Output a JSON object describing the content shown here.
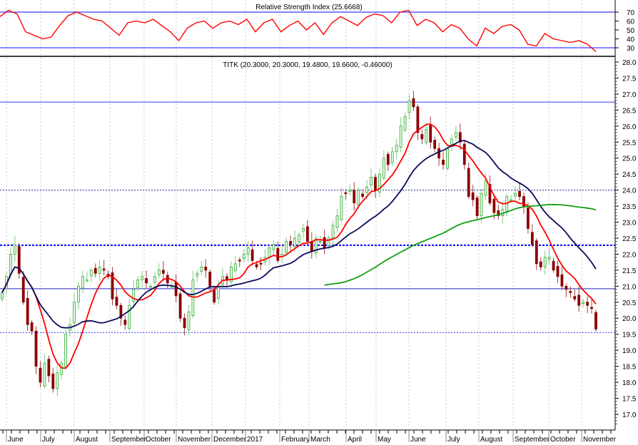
{
  "chart_data": {
    "type": "candlestick",
    "symbol": "TITK",
    "title": "TITK (20.3000, 20.3000, 19.4800, 19.6600, -0.46000)",
    "ylim": [
      16.5,
      28.2
    ],
    "y_ticks": [
      "28.0",
      "27.5",
      "27.0",
      "26.5",
      "26.0",
      "25.5",
      "25.0",
      "24.5",
      "24.0",
      "23.5",
      "23.0",
      "22.5",
      "22.0",
      "21.5",
      "21.0",
      "20.5",
      "20.0",
      "19.5",
      "19.0",
      "18.5",
      "18.0",
      "17.5",
      "17.0"
    ],
    "x_labels": [
      "June",
      "July",
      "August",
      "September",
      "October",
      "November",
      "December",
      "2017",
      "February",
      "March",
      "April",
      "May",
      "June",
      "July",
      "August",
      "September",
      "October",
      "November"
    ],
    "closes": [
      20.8,
      21.3,
      22.0,
      22.3,
      21.4,
      20.5,
      19.8,
      19.6,
      18.5,
      18.0,
      18.6,
      18.2,
      17.8,
      18.3,
      18.6,
      19.5,
      19.8,
      20.5,
      21.0,
      21.3,
      21.2,
      21.5,
      21.4,
      21.6,
      21.5,
      21.3,
      20.6,
      20.4,
      20.0,
      19.8,
      20.4,
      20.9,
      21.2,
      21.3,
      21.1,
      21.0,
      21.3,
      21.5,
      21.4,
      21.1,
      21.0,
      20.7,
      20.0,
      19.7,
      20.2,
      21.2,
      21.4,
      21.6,
      21.5,
      21.0,
      20.5,
      21.0,
      21.3,
      21.2,
      21.6,
      21.7,
      21.8,
      22.0,
      22.2,
      21.8,
      21.6,
      21.7,
      21.9,
      22.2,
      22.3,
      21.8,
      22.0,
      22.4,
      22.3,
      22.5,
      22.6,
      22.8,
      22.4,
      22.1,
      22.5,
      22.4,
      22.2,
      22.5,
      22.9,
      23.2,
      23.8,
      23.9,
      24.0,
      23.6,
      24.0,
      23.8,
      24.1,
      24.4,
      24.0,
      24.5,
      25.0,
      24.8,
      25.2,
      25.4,
      26.0,
      26.3,
      26.8,
      26.6,
      25.8,
      25.6,
      25.9,
      25.5,
      25.3,
      25.0,
      24.8,
      25.3,
      25.6,
      25.8,
      25.5,
      24.8,
      23.8,
      23.7,
      23.2,
      23.9,
      24.3,
      23.6,
      23.3,
      23.2,
      23.4,
      23.8,
      23.7,
      23.9,
      23.8,
      23.5,
      22.8,
      22.3,
      21.7,
      21.6,
      21.9,
      21.9,
      21.5,
      21.3,
      21.0,
      20.9,
      20.8,
      20.6,
      20.4,
      20.5,
      20.4,
      20.3,
      19.66
    ],
    "moving_averages": [
      {
        "name": "short",
        "period_points": 8,
        "color": "#ff0000"
      },
      {
        "name": "medium",
        "period_points": 20,
        "color": "#0a0a5a"
      },
      {
        "name": "long",
        "period_points": 77,
        "color": "#10a010"
      }
    ],
    "horizontal_levels": [
      {
        "value": 26.75,
        "style": "solid",
        "color": "#3a3aff"
      },
      {
        "value": 24.0,
        "style": "dotted",
        "color": "#2020a0"
      },
      {
        "value": 22.28,
        "style": "dotted-bold",
        "color": "#0000ff"
      },
      {
        "value": 20.92,
        "style": "solid",
        "color": "#2020c0"
      },
      {
        "value": 19.55,
        "style": "dotted",
        "color": "#3a3aff"
      }
    ],
    "up_color": "#33aa33",
    "down_color": "#8b0000",
    "rsi": {
      "title": "Relative Strength Index (25.6668)",
      "last": 25.6668,
      "ylim": [
        20,
        80
      ],
      "ticks": [
        "70",
        "60",
        "50",
        "40",
        "30"
      ],
      "levels": [
        70,
        30
      ],
      "color": "#ff0000",
      "values": [
        65,
        72,
        68,
        48,
        44,
        40,
        42,
        55,
        66,
        70,
        66,
        62,
        60,
        52,
        44,
        58,
        60,
        58,
        62,
        55,
        48,
        38,
        52,
        58,
        60,
        52,
        58,
        60,
        56,
        62,
        48,
        58,
        62,
        48,
        55,
        60,
        50,
        58,
        45,
        58,
        65,
        60,
        55,
        64,
        68,
        66,
        58,
        70,
        72,
        55,
        62,
        58,
        48,
        56,
        52,
        40,
        32,
        52,
        46,
        54,
        56,
        50,
        34,
        32,
        46,
        40,
        38,
        36,
        38,
        34,
        25.67
      ]
    }
  }
}
